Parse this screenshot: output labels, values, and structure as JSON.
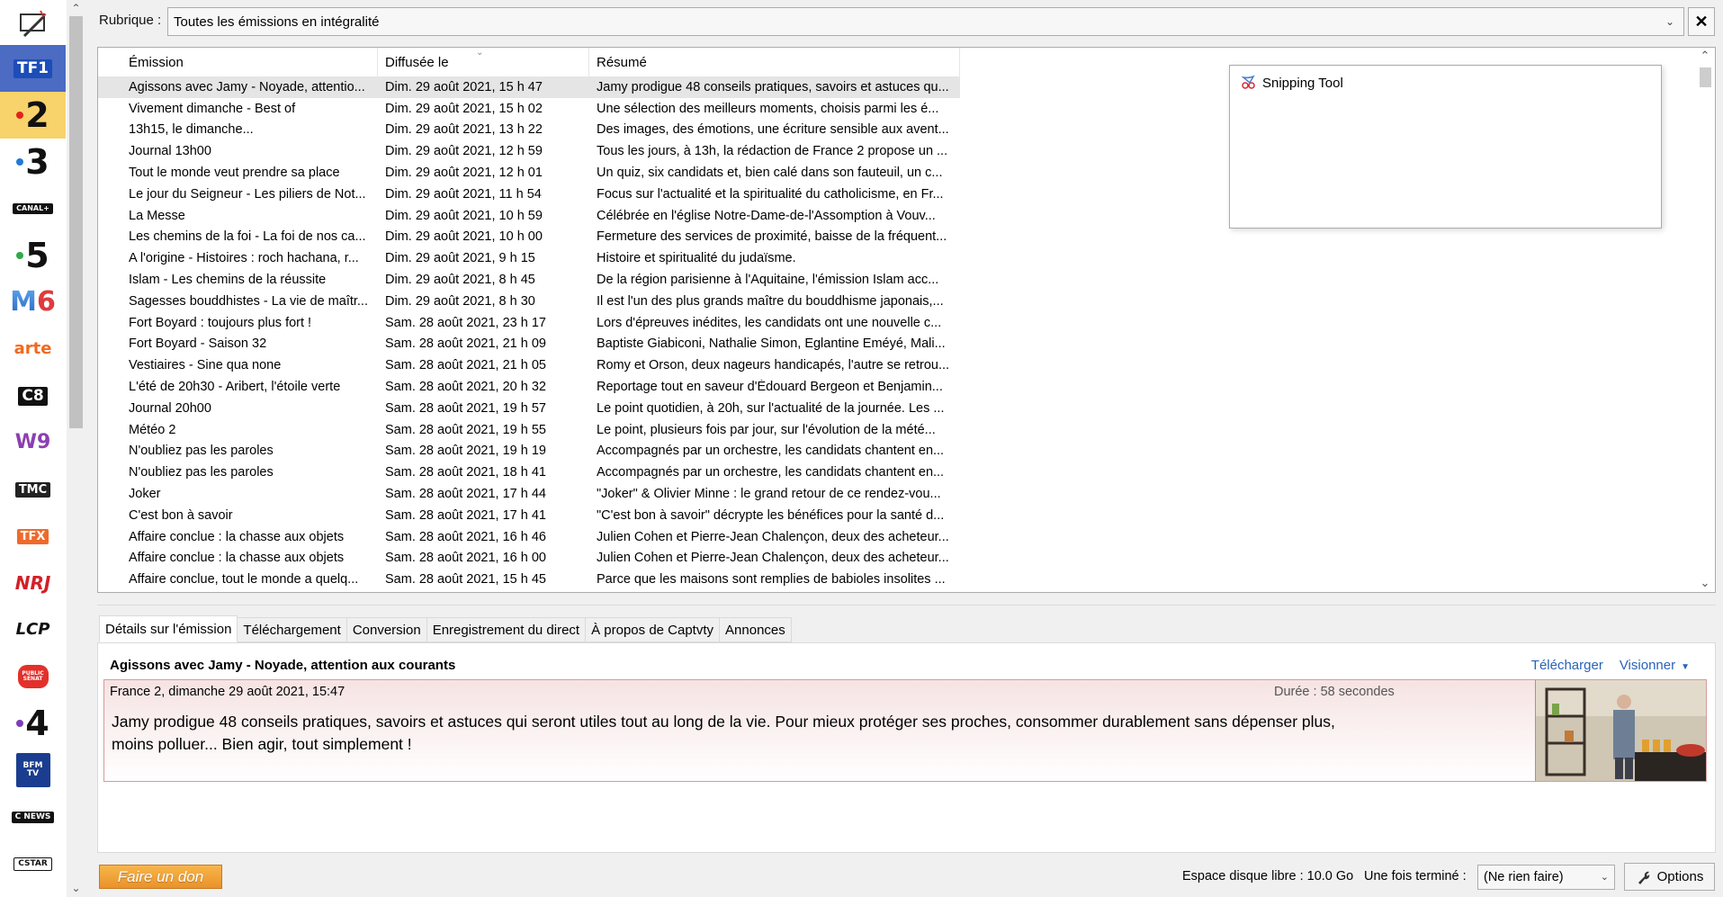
{
  "sidebar": {
    "channels": [
      {
        "name": "settings-icon",
        "label": ""
      },
      {
        "name": "tf1",
        "label": "TF1"
      },
      {
        "name": "france-2",
        "label": "2"
      },
      {
        "name": "france-3",
        "label": "3"
      },
      {
        "name": "canal-plus",
        "label": "CANAL+"
      },
      {
        "name": "france-5",
        "label": "5"
      },
      {
        "name": "m6",
        "label": "6"
      },
      {
        "name": "arte",
        "label": "arte"
      },
      {
        "name": "c8",
        "label": "C8"
      },
      {
        "name": "w9",
        "label": "W9"
      },
      {
        "name": "tmc",
        "label": "TMC"
      },
      {
        "name": "tfx",
        "label": "TFX"
      },
      {
        "name": "nrj12",
        "label": "NRJ"
      },
      {
        "name": "lcp",
        "label": "LCP"
      },
      {
        "name": "public-senat",
        "label": "PUBLIC SÉNAT"
      },
      {
        "name": "france-4",
        "label": "4"
      },
      {
        "name": "bfm-tv",
        "label": "BFM TV"
      },
      {
        "name": "cnews",
        "label": "C NEWS"
      },
      {
        "name": "cstar",
        "label": "CSTAR"
      }
    ]
  },
  "rubrique": {
    "label": "Rubrique :",
    "value": "Toutes les émissions en intégralité"
  },
  "list": {
    "columns": [
      "Émission",
      "Diffusée le",
      "Résumé"
    ],
    "rows": [
      [
        "Agissons avec Jamy - Noyade, attentio...",
        "Dim. 29 août 2021, 15 h 47",
        "Jamy prodigue 48 conseils pratiques, savoirs et astuces qu..."
      ],
      [
        "Vivement dimanche - Best of",
        "Dim. 29 août 2021, 15 h 02",
        "Une sélection des meilleurs moments, choisis parmi les é..."
      ],
      [
        "13h15, le dimanche...",
        "Dim. 29 août 2021, 13 h 22",
        "Des images, des émotions, une écriture sensible aux avent..."
      ],
      [
        "Journal 13h00",
        "Dim. 29 août 2021, 12 h 59",
        "Tous les jours, à 13h, la rédaction de France 2 propose un ..."
      ],
      [
        "Tout le monde veut prendre sa place",
        "Dim. 29 août 2021, 12 h 01",
        "Un quiz, six candidats et, bien calé dans son fauteuil, un c..."
      ],
      [
        "Le jour du Seigneur - Les piliers de Not...",
        "Dim. 29 août 2021, 11 h 54",
        "Focus sur l'actualité et la spiritualité du catholicisme, en Fr..."
      ],
      [
        "La Messe",
        "Dim. 29 août 2021, 10 h 59",
        "Célébrée en l'église Notre-Dame-de-l'Assomption à Vouv..."
      ],
      [
        "Les chemins de la foi - La foi de nos ca...",
        "Dim. 29 août 2021, 10 h 00",
        "Fermeture des services de proximité, baisse de la fréquent..."
      ],
      [
        "A l'origine - Histoires : roch hachana, r...",
        "Dim. 29 août 2021, 9 h 15",
        "Histoire et spiritualité du judaïsme."
      ],
      [
        "Islam - Les chemins de la réussite",
        "Dim. 29 août 2021, 8 h 45",
        "De la région parisienne à l'Aquitaine, l'émission Islam acc..."
      ],
      [
        "Sagesses bouddhistes - La vie de maîtr...",
        "Dim. 29 août 2021, 8 h 30",
        "Il est l'un des plus grands maître du bouddhisme japonais,..."
      ],
      [
        "Fort Boyard : toujours plus fort !",
        "Sam. 28 août 2021, 23 h 17",
        "Lors d'épreuves inédites, les candidats ont une nouvelle c..."
      ],
      [
        "Fort Boyard - Saison 32",
        "Sam. 28 août 2021, 21 h 09",
        "Baptiste Giabiconi, Nathalie Simon, Eglantine Eméyé, Mali..."
      ],
      [
        "Vestiaires - Sine qua none",
        "Sam. 28 août 2021, 21 h 05",
        "Romy et Orson, deux nageurs handicapés, l'autre se retrou..."
      ],
      [
        "L'été de 20h30 - Aribert, l'étoile verte",
        "Sam. 28 août 2021, 20 h 32",
        "Reportage tout en saveur d'Édouard Bergeon et Benjamin..."
      ],
      [
        "Journal 20h00",
        "Sam. 28 août 2021, 19 h 57",
        "Le point quotidien, à 20h, sur l'actualité de la journée. Les ..."
      ],
      [
        "Météo 2",
        "Sam. 28 août 2021, 19 h 55",
        "Le point, plusieurs fois par jour, sur l'évolution de la mété..."
      ],
      [
        "N'oubliez pas les paroles",
        "Sam. 28 août 2021, 19 h 19",
        "Accompagnés par un orchestre, les candidats chantent en..."
      ],
      [
        "N'oubliez pas les paroles",
        "Sam. 28 août 2021, 18 h 41",
        "Accompagnés par un orchestre, les candidats chantent en..."
      ],
      [
        "Joker",
        "Sam. 28 août 2021, 17 h 44",
        "\"Joker\" & Olivier Minne : le grand retour de ce rendez-vou..."
      ],
      [
        "C'est bon à savoir",
        "Sam. 28 août 2021, 17 h 41",
        "\"C'est bon à savoir\" décrypte les bénéfices pour la santé d..."
      ],
      [
        "Affaire conclue : la chasse aux objets",
        "Sam. 28 août 2021, 16 h 46",
        "Julien Cohen et Pierre-Jean Chalençon, deux des acheteur..."
      ],
      [
        "Affaire conclue : la chasse aux objets",
        "Sam. 28 août 2021, 16 h 00",
        "Julien Cohen et Pierre-Jean Chalençon, deux des acheteur..."
      ],
      [
        "Affaire conclue, tout le monde a quelq...",
        "Sam. 28 août 2021, 15 h 45",
        "Parce que les maisons sont remplies de babioles insolites ..."
      ]
    ]
  },
  "snipping_tool": {
    "title": "Snipping Tool"
  },
  "tabs": [
    "Détails sur l'émission",
    "Téléchargement",
    "Conversion",
    "Enregistrement du direct",
    "À propos de Captvty",
    "Annonces"
  ],
  "details": {
    "title": "Agissons avec Jamy - Noyade, attention aux courants",
    "download": "Télécharger",
    "watch": "Visionner",
    "meta": "France 2, dimanche 29 août 2021, 15:47",
    "duration": "Durée : 58 secondes",
    "description": "Jamy prodigue 48 conseils pratiques, savoirs et astuces qui seront utiles tout au long de la vie. Pour mieux protéger ses proches, consommer durablement sans dépenser plus, moins polluer... Bien agir, tout simplement !"
  },
  "footer": {
    "donate": "Faire un don",
    "disk_space": "Espace disque libre : 10.0 Go",
    "when_done_label": "Une fois terminé :",
    "when_done_value": "(Ne rien faire)",
    "options": "Options"
  },
  "colors": {
    "accent_link": "#2a63b8",
    "selected_channel": "#f8d26a",
    "donate": "#f0a23a"
  }
}
